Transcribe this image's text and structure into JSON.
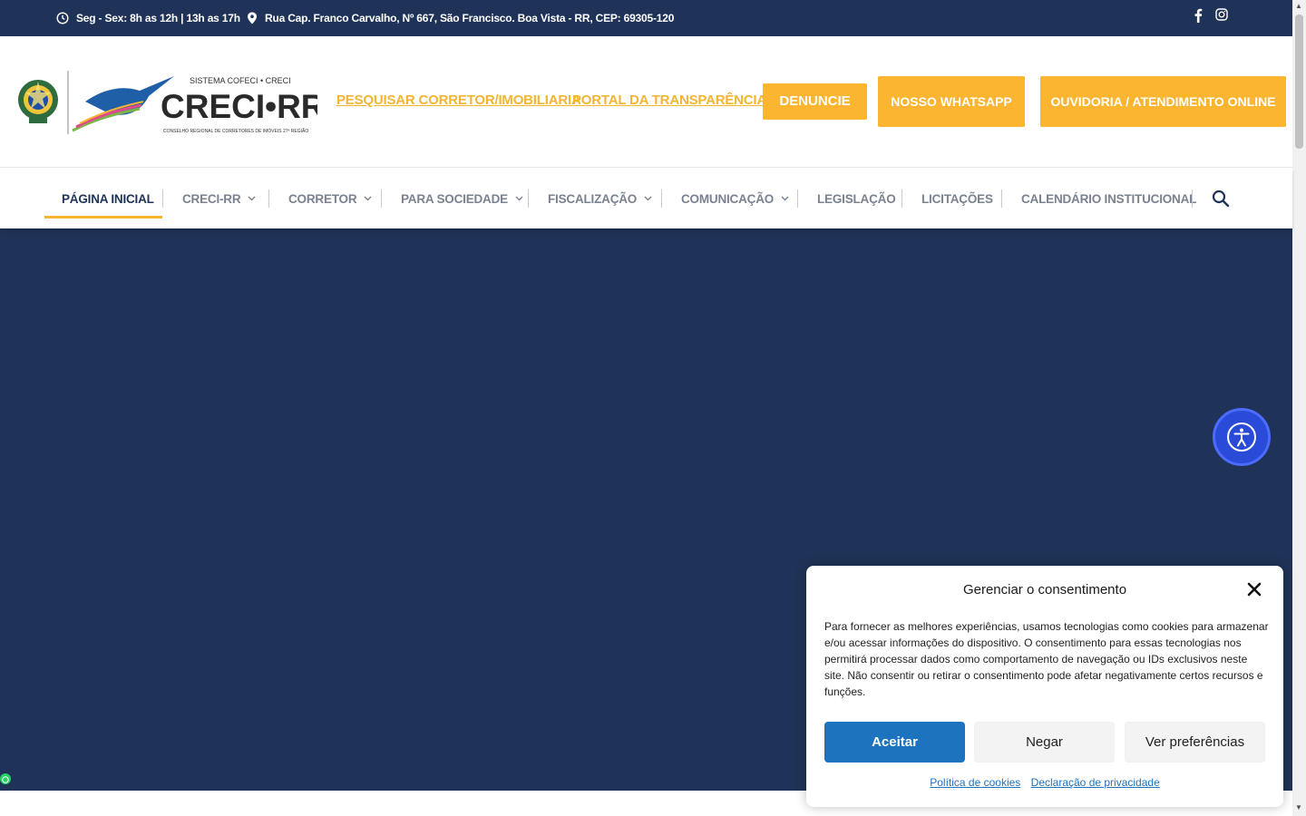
{
  "topbar": {
    "hours": "Seg - Sex: 8h as 12h | 13h as 17h",
    "address": "Rua Cap. Franco Carvalho, Nº 667, São Francisco. Boa Vista - RR, CEP: 69305-120"
  },
  "logo": {
    "tagline": "SISTEMA COFECI • CRECI",
    "name": "CRECI•RR",
    "subtitle": "CONSELHO REGIONAL DE CORRETORES DE IMÓVEIS 27ª REGIÃO"
  },
  "header": {
    "link_search_broker": "PESQUISAR CORRETOR/IMOBILIARIA",
    "link_transparency": "PORTAL DA TRANSPARÊNCIA",
    "btn_denounce": "DENUNCIE",
    "btn_whatsapp": "NOSSO WHATSAPP",
    "btn_ombudsman": "OUVIDORIA / ATENDIMENTO ONLINE"
  },
  "nav": {
    "items": [
      {
        "label": "PÁGINA INICIAL"
      },
      {
        "label": "CRECI-RR"
      },
      {
        "label": "CORRETOR"
      },
      {
        "label": "PARA SOCIEDADE"
      },
      {
        "label": "FISCALIZAÇÃO"
      },
      {
        "label": "COMUNICAÇÃO"
      },
      {
        "label": "LEGISLAÇÃO"
      },
      {
        "label": "LICITAÇÕES"
      },
      {
        "label": "CALENDÁRIO INSTITUCIONAL"
      }
    ]
  },
  "consent": {
    "title": "Gerenciar o consentimento",
    "text": "Para fornecer as melhores experiências, usamos tecnologias como cookies para armazenar e/ou acessar informações do dispositivo. O consentimento para essas tecnologias nos permitirá processar dados como comportamento de navegação ou IDs exclusivos neste site. Não consentir ou retirar o consentimento pode afetar negativamente certos recursos e funções.",
    "accept": "Aceitar",
    "deny": "Negar",
    "preferences": "Ver preferências",
    "cookie_policy": "Política de cookies",
    "privacy_statement": "Declaração de privacidade"
  },
  "colors": {
    "navy": "#1f3358",
    "accent": "#fbb531",
    "accept_blue": "#1e73be",
    "a11y_blue": "#2a4ad8"
  },
  "icons": [
    "clock-icon",
    "map-pin-icon",
    "facebook-icon",
    "instagram-icon",
    "chevron-down-icon",
    "search-icon",
    "accessibility-icon",
    "close-icon",
    "whatsapp-icon"
  ]
}
